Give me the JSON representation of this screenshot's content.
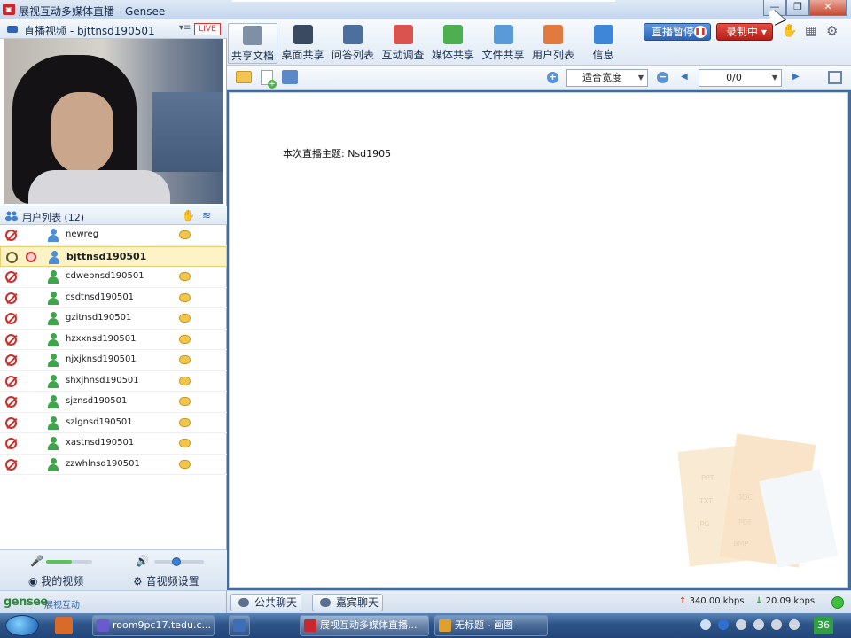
{
  "window": {
    "title": "展视互动多媒体直播 - Gensee",
    "min_label": "—",
    "max_label": "❐",
    "close_label": "✕"
  },
  "video_panel": {
    "label": "直播视频 - bjttnsd190501",
    "menu_glyph": "▾≡",
    "live_badge": "LIVE"
  },
  "user_list": {
    "label": "用户列表 (12)",
    "users": [
      {
        "name": "newreg",
        "role": "host",
        "mic": "off",
        "chat": true
      },
      {
        "name": "bjttnsd190501",
        "role": "self",
        "mic": "on",
        "chat": false,
        "selected": true
      },
      {
        "name": "cdwebnsd190501",
        "role": "attendee",
        "mic": "off",
        "chat": true
      },
      {
        "name": "csdtnsd190501",
        "role": "attendee",
        "mic": "off",
        "chat": true
      },
      {
        "name": "gzitnsd190501",
        "role": "attendee",
        "mic": "off",
        "chat": true
      },
      {
        "name": "hzxxnsd190501",
        "role": "attendee",
        "mic": "off",
        "chat": true
      },
      {
        "name": "njxjknsd190501",
        "role": "attendee",
        "mic": "off",
        "chat": true
      },
      {
        "name": "shxjhnsd190501",
        "role": "attendee",
        "mic": "off",
        "chat": true
      },
      {
        "name": "sjznsd190501",
        "role": "attendee",
        "mic": "off",
        "chat": true
      },
      {
        "name": "szlgnsd190501",
        "role": "attendee",
        "mic": "off",
        "chat": true
      },
      {
        "name": "xastnsd190501",
        "role": "attendee",
        "mic": "off",
        "chat": true
      },
      {
        "name": "zzwhlnsd190501",
        "role": "attendee",
        "mic": "off",
        "chat": true
      }
    ]
  },
  "left_footer": {
    "mic_level": 0.55,
    "speaker_level": 0.45,
    "my_video": "我的视频",
    "av_settings": "音视频设置"
  },
  "toolbar": {
    "tabs": [
      {
        "label": "共享文档",
        "icon": "document-icon",
        "color": "#7f8fa6",
        "active": true
      },
      {
        "label": "桌面共享",
        "icon": "desktop-share-icon",
        "color": "#3a4a60"
      },
      {
        "label": "问答列表",
        "icon": "qa-icon",
        "color": "#4d6f9e"
      },
      {
        "label": "互动调查",
        "icon": "survey-icon",
        "color": "#d9534f"
      },
      {
        "label": "媒体共享",
        "icon": "media-share-icon",
        "color": "#4caf50"
      },
      {
        "label": "文件共享",
        "icon": "file-share-icon",
        "color": "#5a9ad8"
      },
      {
        "label": "用户列表",
        "icon": "users-icon",
        "color": "#e07a3f"
      },
      {
        "label": "信息",
        "icon": "info-icon",
        "color": "#3d86d8"
      }
    ],
    "pause_label": "直播暂停",
    "record_label": "录制中 ▾"
  },
  "doc_toolbar": {
    "zoom_value": "适合宽度",
    "page_value": "0/0"
  },
  "document": {
    "topic": "本次直播主题: Nsd1905",
    "watermark": [
      "PPT",
      "DOC",
      "TXT",
      "PDF",
      "JPG",
      "BMP"
    ]
  },
  "chat": {
    "public_label": "公共聊天",
    "guest_label": "嘉宾聊天"
  },
  "bandwidth": {
    "up": "340.00 kbps",
    "down": "20.09 kbps"
  },
  "brand": {
    "logo": "gensee",
    "sub": "展视互动"
  },
  "taskbar": {
    "items": [
      {
        "label": "room9pc17.tedu.c...",
        "color": "#6a5acd"
      },
      {
        "label": "",
        "color": "#3c6fb5"
      },
      {
        "label": "展视互动多媒体直播...",
        "color": "#c8282d",
        "active": true
      },
      {
        "label": "无标题 - 画图",
        "color": "#e0a030"
      }
    ],
    "tray_number": "36"
  },
  "colors": {
    "accent": "#2e63b5",
    "record": "#b51f17",
    "online": "#3fbf3c"
  }
}
